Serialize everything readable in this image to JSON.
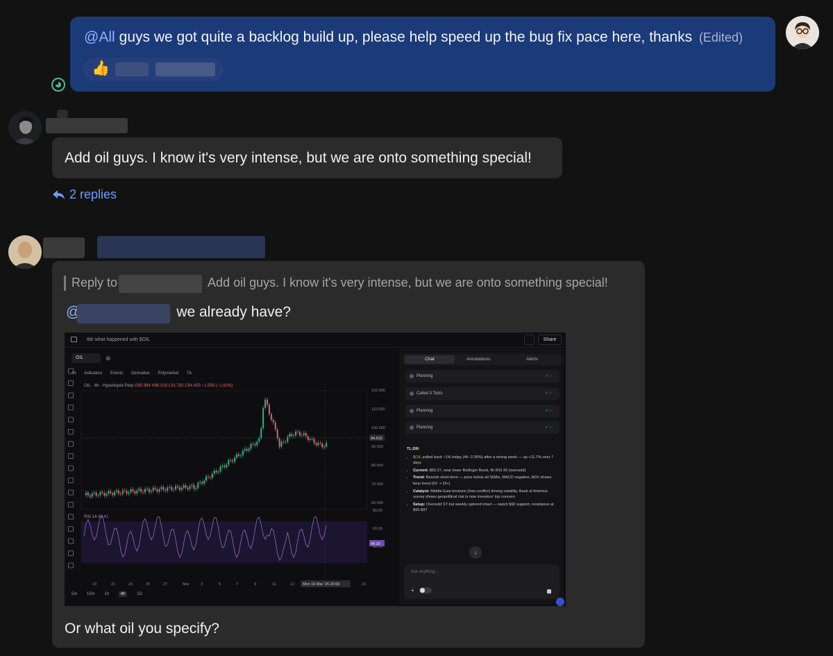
{
  "messages": {
    "own": {
      "mention": "@All",
      "text": "guys we got quite a backlog build up, please help speed up the bug fix pace here, thanks",
      "edited": "(Edited)",
      "reaction_emoji": "👍"
    },
    "second": {
      "text": "Add oil guys. I know it's very intense, but we are onto something special!",
      "replies_label": "2 replies"
    },
    "third": {
      "reply_prefix": "Reply to",
      "reply_snippet": "Add oil guys. I know it's very intense, but we are onto something special!",
      "mention_at": "@",
      "text": "we already have?",
      "caption": "Or what oil you specify?"
    }
  },
  "screenshot": {
    "title": "tldr what happened with $OIL",
    "share_label": "Share",
    "symbol_tab": "OIL",
    "timeframe": "4h",
    "toolbar": [
      "Indicators",
      "Events",
      "Derivative",
      "Polymarket",
      "TA"
    ],
    "legend_prefix": "OIL · 4h · Hyperliquid Perp",
    "legend_ohlc": "O95.984 H96.518 L91.782 C94.455 −1.559 (−1.62%)",
    "rsi_label": "RSI 14",
    "rsi_value": "45.41",
    "price_ticks": [
      "120.000",
      "110.000",
      "100.000",
      "90.000",
      "80.000",
      "70.000",
      "60.000"
    ],
    "rsi_ticks": [
      "80.00",
      "60.00",
      "40.00"
    ],
    "price_badge": "94.515",
    "rsi_badge": "44.20",
    "x_ticks": [
      "19",
      "21",
      "23",
      "25",
      "27",
      "Mar",
      "3",
      "5",
      "7",
      "9",
      "11",
      "13",
      "21"
    ],
    "crosshair_label": "Mon 16 Mar '26  20:00",
    "timeframes": [
      "5m",
      "15m",
      "1h",
      "4h",
      "1D"
    ],
    "side_tabs": [
      "Chat",
      "Annotations",
      "Alerts"
    ],
    "steps": [
      "Planning",
      "Called 3 Tools",
      "Planning",
      "Planning"
    ],
    "tldr_heading": "TL;DR:",
    "tldr": {
      "b1_ticker": "$OIL",
      "b1_text": "pulled back ~1% today (4h -2.36%) after a strong week — up +11.7% over 7 days",
      "b2_label": "Current:",
      "b2_text": "$93.27, near lower Bollinger Band, 4h RSI 39 (oversold)",
      "b3_label": "Trend:",
      "b3_text": "Bearish short-term — price below all SMAs, MACD negative, ADX shows bear trend (DI- > DI+)",
      "b4_label": "Catalyst:",
      "b4_text": "Middle East tensions (Iran conflict) driving volatility. Bank of America survey shows geopolitical risk is now investors' top concern",
      "b5_label": "Setup:",
      "b5_text": "Oversold ST but weekly uptrend intact — watch $92 support, resistance at $95-$97"
    },
    "ask_placeholder": "Ask anything..."
  },
  "colors": {
    "own_bubble": "#1b3a78",
    "other_bubble": "#2b2b2b",
    "mention": "#8fb2ff",
    "link": "#6f9cff",
    "up_candle": "#2fb38a",
    "down_candle": "#e0626c",
    "rsi_line": "#9b7ad8"
  }
}
